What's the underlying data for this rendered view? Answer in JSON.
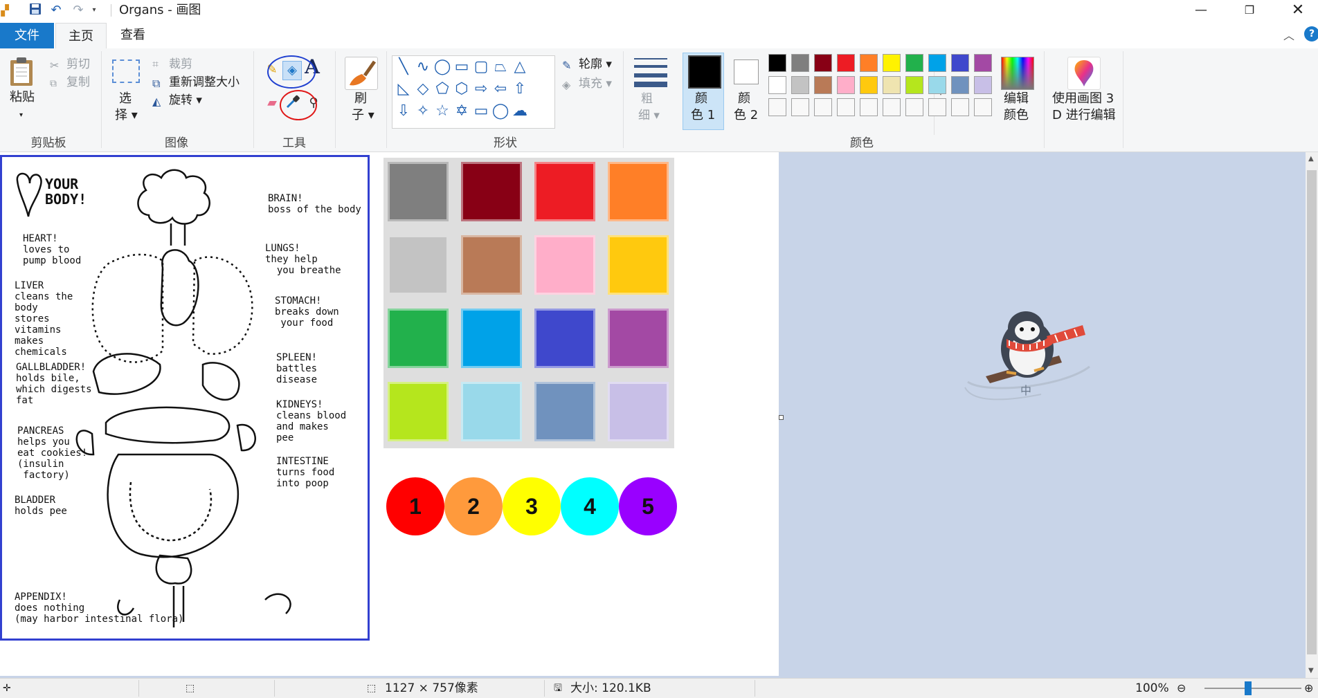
{
  "window": {
    "title": "Organs - 画图",
    "minimize": "—",
    "maximize": "❐",
    "close": "✕"
  },
  "tabs": [
    {
      "label": "文件"
    },
    {
      "label": "主页"
    },
    {
      "label": "查看"
    }
  ],
  "ribbon": {
    "clipboard": {
      "paste_l1": "粘贴",
      "paste_arrow": "▾",
      "cut": "剪切",
      "copy": "复制",
      "group": "剪贴板"
    },
    "image": {
      "select_l1": "选",
      "select_l2": "择 ▾",
      "crop": "裁剪",
      "resize": "重新调整大小",
      "rotate": "旋转 ▾",
      "group": "图像"
    },
    "tools": {
      "group": "工具"
    },
    "brushes": {
      "l1": "刷",
      "l2": "子 ▾"
    },
    "shapes": {
      "outline": "轮廓 ▾",
      "fill": "填充 ▾",
      "group": "形状"
    },
    "size": {
      "l1": "粗",
      "l2": "细 ▾"
    },
    "colors": {
      "color1_l1": "颜",
      "color1_l2": "色 1",
      "color2_l1": "颜",
      "color2_l2": "色 2",
      "edit_l1": "编辑",
      "edit_l2": "颜色",
      "group": "颜色",
      "palette": [
        "#000000",
        "#7f7f7f",
        "#880015",
        "#ed1c24",
        "#ff7f27",
        "#fff200",
        "#22b14c",
        "#00a2e8",
        "#3f48cc",
        "#a349a4",
        "#ffffff",
        "#c3c3c3",
        "#b97a57",
        "#ffaec9",
        "#ffc90e",
        "#efe4b0",
        "#b5e61d",
        "#99d9ea",
        "#7092be",
        "#c8bfe7",
        "#f8f8f8",
        "#f8f8f8",
        "#f8f8f8",
        "#f8f8f8",
        "#f8f8f8",
        "#f8f8f8",
        "#f8f8f8",
        "#f8f8f8",
        "#f8f8f8",
        "#f8f8f8"
      ]
    },
    "paint3d": {
      "l1": "使用画图 3",
      "l2": "D 进行编辑"
    }
  },
  "canvas": {
    "doodle": {
      "your_body": "YOUR\nBODY!",
      "heart": "HEART!\nloves to\npump blood",
      "brain": "BRAIN!\nboss of the body",
      "lungs": "LUNGS!\nthey help\n  you breathe",
      "liver": "LIVER\ncleans the\nbody\nstores\nvitamins\nmakes\nchemicals",
      "stomach": "STOMACH!\nbreaks down\n your food",
      "spleen": "SPLEEN!\nbattles\ndisease",
      "gallbladder": "GALLBLADDER!\nholds bile,\nwhich digests\nfat",
      "kidneys": "KIDNEYS!\ncleans blood\nand makes\npee",
      "pancreas": "PANCREAS\nhelps you\neat cookies!\n(insulin\n factory)",
      "intestine": "INTESTINE\nturns food\ninto poop",
      "bladder": "BLADDER\nholds pee",
      "appendix": "APPENDIX!\ndoes nothing\n(may harbor intestinal flora)"
    },
    "swatches": [
      "#7f7f7f",
      "#880015",
      "#ed1c24",
      "#ff7f27",
      "#c3c3c3",
      "#b97a57",
      "#ffaec9",
      "#ffc90e",
      "#22b14c",
      "#00a2e8",
      "#3f48cc",
      "#a349a4",
      "#b5e61d",
      "#99d9ea",
      "#7092be",
      "#c8bfe7"
    ],
    "circles": [
      {
        "label": "1",
        "color": "#ff0000"
      },
      {
        "label": "2",
        "color": "#ff9a3c"
      },
      {
        "label": "3",
        "color": "#ffff00"
      },
      {
        "label": "4",
        "color": "#00ffff"
      },
      {
        "label": "5",
        "color": "#9900ff"
      }
    ]
  },
  "status": {
    "dimensions": "1127 × 757像素",
    "size": "大小: 120.1KB",
    "zoom": "100%"
  }
}
